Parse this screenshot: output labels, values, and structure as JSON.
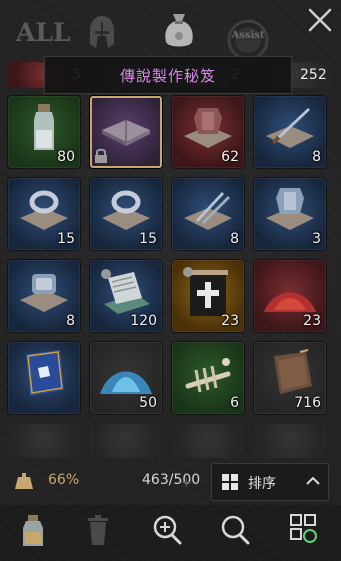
{
  "tabs": {
    "all_label": "ALL",
    "assist_label": "Assist",
    "icons": [
      "helmet-icon",
      "bag-icon",
      "assist-icon",
      "close-icon"
    ]
  },
  "tooltip": {
    "text": "傳說製作秘笈"
  },
  "partial_row": {
    "counts": [
      "5",
      "2",
      "252"
    ]
  },
  "slots": [
    {
      "icon": "potion-bottle-icon",
      "quality": "green",
      "count": "80"
    },
    {
      "icon": "recipe-book-icon",
      "quality": "purple",
      "count": "",
      "locked": true,
      "selected": true
    },
    {
      "icon": "armor-recipe-icon",
      "quality": "red",
      "count": "62"
    },
    {
      "icon": "sword-recipe-icon",
      "quality": "blue",
      "count": "8"
    },
    {
      "icon": "ring-recipe-icon",
      "quality": "blue",
      "count": "15"
    },
    {
      "icon": "ring-recipe-icon",
      "quality": "blue",
      "count": "15"
    },
    {
      "icon": "dagger-recipe-icon",
      "quality": "blue",
      "count": "8"
    },
    {
      "icon": "armor-recipe-icon",
      "quality": "blue",
      "count": "3"
    },
    {
      "icon": "gauntlet-recipe-icon",
      "quality": "blue",
      "count": "8"
    },
    {
      "icon": "scroll-stack-icon",
      "quality": "blue",
      "count": "120"
    },
    {
      "icon": "cross-scroll-icon",
      "quality": "gold",
      "count": "23"
    },
    {
      "icon": "red-powder-icon",
      "quality": "red",
      "count": "23"
    },
    {
      "icon": "spellbook-icon",
      "quality": "blue",
      "count": ""
    },
    {
      "icon": "blue-powder-icon",
      "quality": "dark",
      "count": "50"
    },
    {
      "icon": "bones-icon",
      "quality": "green",
      "count": "6"
    },
    {
      "icon": "leather-icon",
      "quality": "dark",
      "count": "716"
    }
  ],
  "status": {
    "weight_percent": "66%",
    "capacity": "463/500",
    "sort_label": "排序"
  },
  "toolbar": {
    "icons": [
      "potion-bottle-icon",
      "trash-icon",
      "zoom-in-icon",
      "search-icon",
      "grid-refresh-icon"
    ]
  },
  "colors": {
    "tooltip_text": "#d98ae8",
    "weight_text": "#c9a86e",
    "selected_border": "#c8a86a"
  }
}
